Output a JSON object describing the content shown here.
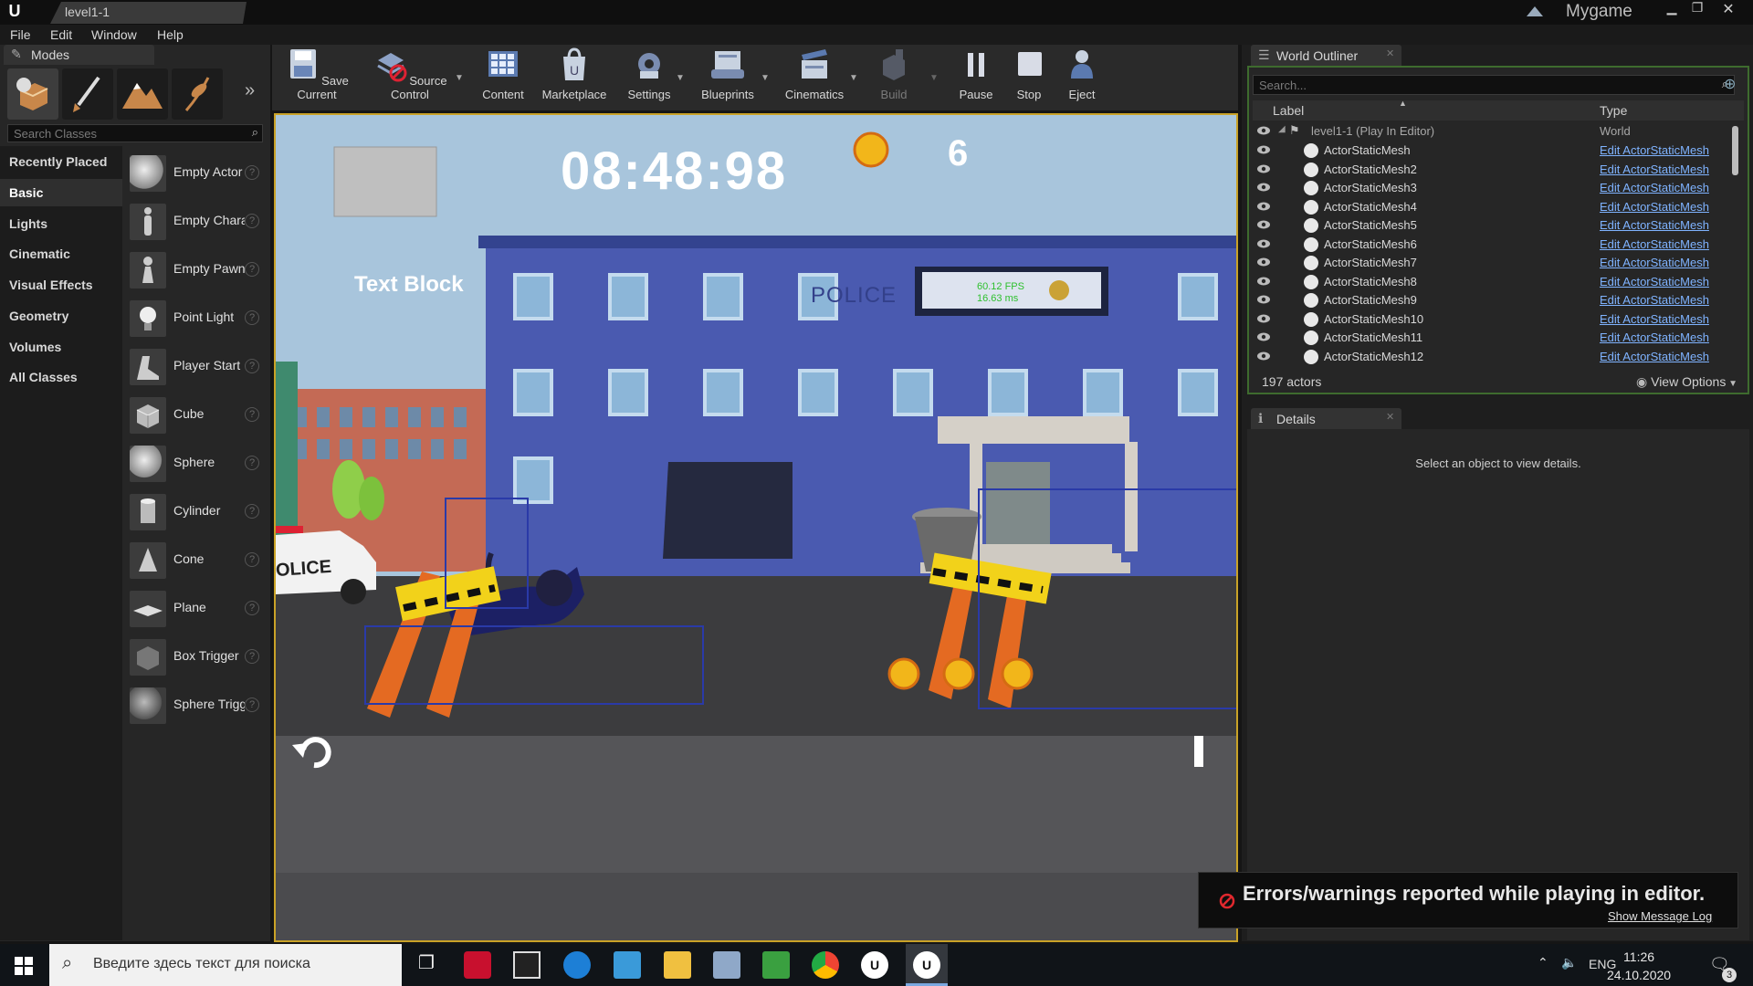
{
  "titlebar": {
    "document_tab": "level1-1",
    "project_name": "Mygame"
  },
  "menu": [
    "File",
    "Edit",
    "Window",
    "Help"
  ],
  "modes": {
    "tab_label": "Modes",
    "search_placeholder": "Search Classes",
    "categories": [
      "Recently Placed",
      "Basic",
      "Lights",
      "Cinematic",
      "Visual Effects",
      "Geometry",
      "Volumes",
      "All Classes"
    ],
    "selected_category": "Basic",
    "items": [
      "Empty Actor",
      "Empty Character",
      "Empty Pawn",
      "Point Light",
      "Player Start",
      "Cube",
      "Sphere",
      "Cylinder",
      "Cone",
      "Plane",
      "Box Trigger",
      "Sphere Trigger"
    ]
  },
  "toolbar": {
    "buttons": [
      "Save Current",
      "Source Control",
      "Content",
      "Marketplace",
      "Settings",
      "Blueprints",
      "Cinematics",
      "Build",
      "Pause",
      "Stop",
      "Eject"
    ]
  },
  "viewport": {
    "timer": "08:48:98",
    "coin_count": "6",
    "text_block": "Text Block",
    "police_sign": "POLICE",
    "police_car_text": "OLICE",
    "fps": "60.12 FPS",
    "ms": "16.63 ms"
  },
  "world_outliner": {
    "tab_label": "World Outliner",
    "search_placeholder": "Search...",
    "col_label": "Label",
    "col_type": "Type",
    "root": {
      "name": "level1-1 (Play In Editor)",
      "type": "World"
    },
    "rows": [
      {
        "name": "ActorStaticMesh",
        "type": "Edit ActorStaticMesh"
      },
      {
        "name": "ActorStaticMesh2",
        "type": "Edit ActorStaticMesh"
      },
      {
        "name": "ActorStaticMesh3",
        "type": "Edit ActorStaticMesh"
      },
      {
        "name": "ActorStaticMesh4",
        "type": "Edit ActorStaticMesh"
      },
      {
        "name": "ActorStaticMesh5",
        "type": "Edit ActorStaticMesh"
      },
      {
        "name": "ActorStaticMesh6",
        "type": "Edit ActorStaticMesh"
      },
      {
        "name": "ActorStaticMesh7",
        "type": "Edit ActorStaticMesh"
      },
      {
        "name": "ActorStaticMesh8",
        "type": "Edit ActorStaticMesh"
      },
      {
        "name": "ActorStaticMesh9",
        "type": "Edit ActorStaticMesh"
      },
      {
        "name": "ActorStaticMesh10",
        "type": "Edit ActorStaticMesh"
      },
      {
        "name": "ActorStaticMesh11",
        "type": "Edit ActorStaticMesh"
      },
      {
        "name": "ActorStaticMesh12",
        "type": "Edit ActorStaticMesh"
      }
    ],
    "actor_count": "197 actors",
    "view_options": "View Options"
  },
  "details": {
    "tab_label": "Details",
    "empty_message": "Select an object to view details."
  },
  "toast": {
    "message": "Errors/warnings reported while playing in editor.",
    "link": "Show Message Log"
  },
  "taskbar": {
    "search_placeholder": "Введите здесь текст для поиска",
    "language": "ENG",
    "time": "11:26",
    "date": "24.10.2020",
    "notifications": "3"
  }
}
